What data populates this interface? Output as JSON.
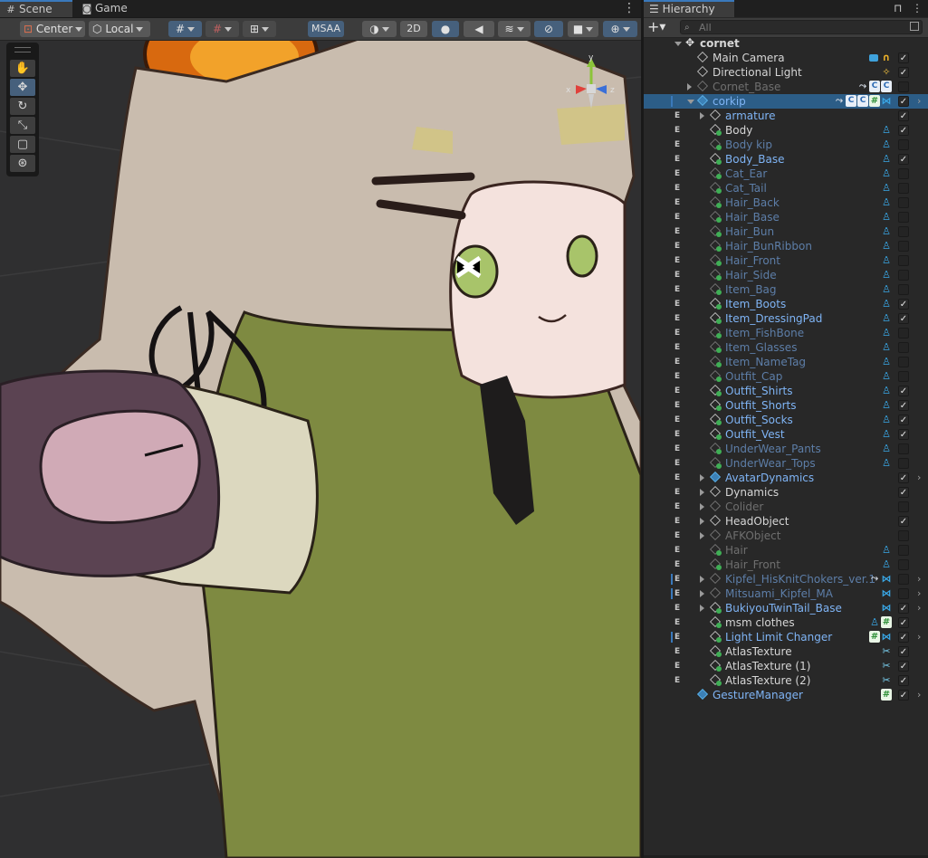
{
  "scene_tabs": [
    {
      "label": "Scene",
      "icon": "scene-grid-icon",
      "active": true
    },
    {
      "label": "Game",
      "icon": "gamepad-icon",
      "active": false
    }
  ],
  "scene_toolbar": {
    "pivot": "Center",
    "space": "Local",
    "msaa": "MSAA",
    "mode_2d": "2D"
  },
  "hierarchy": {
    "tab_label": "Hierarchy",
    "search_placeholder": "All",
    "rows": [
      {
        "label": "cornet",
        "depth": 0,
        "icon": "scene",
        "fold": "down",
        "style": "white",
        "e": false,
        "check": null,
        "badges": [],
        "arrow": false
      },
      {
        "label": "Main Camera",
        "depth": 1,
        "icon": "cube",
        "fold": "",
        "style": "white",
        "e": true,
        "check": true,
        "badges": [
          "camera-icon",
          "audio-listener-icon"
        ],
        "arrow": false
      },
      {
        "label": "Directional Light",
        "depth": 1,
        "icon": "cube",
        "fold": "",
        "style": "white",
        "e": true,
        "check": true,
        "badges": [
          "light-icon"
        ],
        "arrow": false
      },
      {
        "label": "Cornet_Base",
        "depth": 1,
        "icon": "cube-dim",
        "fold": "right",
        "style": "dim",
        "e": true,
        "check": false,
        "badges": [
          "armature-icon",
          "script-doc-icon",
          "script-doc-icon"
        ],
        "arrow": false
      },
      {
        "label": "corkip",
        "depth": 1,
        "icon": "cube-blue",
        "fold": "down",
        "style": "blue",
        "e": false,
        "bar": true,
        "selected": true,
        "check": true,
        "badges": [
          "armature-icon",
          "script-doc-icon",
          "script-doc-icon",
          "hash-script-icon",
          "physbone-icon"
        ],
        "arrow": true
      },
      {
        "label": "armature",
        "depth": 2,
        "icon": "cube",
        "fold": "right",
        "style": "blue",
        "e": true,
        "check": true,
        "badges": [],
        "arrow": false
      },
      {
        "label": "Body",
        "depth": 2,
        "icon": "mesh-cube",
        "fold": "",
        "style": "white",
        "e": true,
        "check": true,
        "badges": [
          "blendshape-icon"
        ],
        "arrow": false
      },
      {
        "label": "Body kip",
        "depth": 2,
        "icon": "mesh-cube-dim",
        "fold": "",
        "style": "dimblue",
        "e": true,
        "check": false,
        "badges": [
          "blendshape-icon"
        ],
        "arrow": false
      },
      {
        "label": "Body_Base",
        "depth": 2,
        "icon": "mesh-cube",
        "fold": "",
        "style": "blue",
        "e": true,
        "check": true,
        "badges": [
          "blendshape-icon"
        ],
        "arrow": false
      },
      {
        "label": "Cat_Ear",
        "depth": 2,
        "icon": "mesh-cube-dim",
        "fold": "",
        "style": "dimblue",
        "e": true,
        "check": false,
        "badges": [
          "blendshape-icon"
        ],
        "arrow": false
      },
      {
        "label": "Cat_Tail",
        "depth": 2,
        "icon": "mesh-cube-dim",
        "fold": "",
        "style": "dimblue",
        "e": true,
        "check": false,
        "badges": [
          "blendshape-icon"
        ],
        "arrow": false
      },
      {
        "label": "Hair_Back",
        "depth": 2,
        "icon": "mesh-cube-dim",
        "fold": "",
        "style": "dimblue",
        "e": true,
        "check": false,
        "badges": [
          "blendshape-icon"
        ],
        "arrow": false
      },
      {
        "label": "Hair_Base",
        "depth": 2,
        "icon": "mesh-cube-dim",
        "fold": "",
        "style": "dimblue",
        "e": true,
        "check": false,
        "badges": [
          "blendshape-icon"
        ],
        "arrow": false
      },
      {
        "label": "Hair_Bun",
        "depth": 2,
        "icon": "mesh-cube-dim",
        "fold": "",
        "style": "dimblue",
        "e": true,
        "check": false,
        "badges": [
          "blendshape-icon"
        ],
        "arrow": false
      },
      {
        "label": "Hair_BunRibbon",
        "depth": 2,
        "icon": "mesh-cube-dim",
        "fold": "",
        "style": "dimblue",
        "e": true,
        "check": false,
        "badges": [
          "blendshape-icon"
        ],
        "arrow": false
      },
      {
        "label": "Hair_Front",
        "depth": 2,
        "icon": "mesh-cube-dim",
        "fold": "",
        "style": "dimblue",
        "e": true,
        "check": false,
        "badges": [
          "blendshape-icon"
        ],
        "arrow": false
      },
      {
        "label": "Hair_Side",
        "depth": 2,
        "icon": "mesh-cube-dim",
        "fold": "",
        "style": "dimblue",
        "e": true,
        "check": false,
        "badges": [
          "blendshape-icon"
        ],
        "arrow": false
      },
      {
        "label": "Item_Bag",
        "depth": 2,
        "icon": "mesh-cube-dim",
        "fold": "",
        "style": "dimblue",
        "e": true,
        "check": false,
        "badges": [
          "blendshape-icon"
        ],
        "arrow": false
      },
      {
        "label": "Item_Boots",
        "depth": 2,
        "icon": "mesh-cube",
        "fold": "",
        "style": "blue",
        "e": true,
        "check": true,
        "badges": [
          "blendshape-icon"
        ],
        "arrow": false
      },
      {
        "label": "Item_DressingPad",
        "depth": 2,
        "icon": "mesh-cube",
        "fold": "",
        "style": "blue",
        "e": true,
        "check": true,
        "badges": [
          "blendshape-icon"
        ],
        "arrow": false
      },
      {
        "label": "Item_FishBone",
        "depth": 2,
        "icon": "mesh-cube-dim",
        "fold": "",
        "style": "dimblue",
        "e": true,
        "check": false,
        "badges": [
          "blendshape-icon"
        ],
        "arrow": false
      },
      {
        "label": "Item_Glasses",
        "depth": 2,
        "icon": "mesh-cube-dim",
        "fold": "",
        "style": "dimblue",
        "e": true,
        "check": false,
        "badges": [
          "blendshape-icon"
        ],
        "arrow": false
      },
      {
        "label": "Item_NameTag",
        "depth": 2,
        "icon": "mesh-cube-dim",
        "fold": "",
        "style": "dimblue",
        "e": true,
        "check": false,
        "badges": [
          "blendshape-icon"
        ],
        "arrow": false
      },
      {
        "label": "Outfit_Cap",
        "depth": 2,
        "icon": "mesh-cube-dim",
        "fold": "",
        "style": "dimblue",
        "e": true,
        "check": false,
        "badges": [
          "blendshape-icon"
        ],
        "arrow": false
      },
      {
        "label": "Outfit_Shirts",
        "depth": 2,
        "icon": "mesh-cube",
        "fold": "",
        "style": "blue",
        "e": true,
        "check": true,
        "badges": [
          "blendshape-icon"
        ],
        "arrow": false
      },
      {
        "label": "Outfit_Shorts",
        "depth": 2,
        "icon": "mesh-cube",
        "fold": "",
        "style": "blue",
        "e": true,
        "check": true,
        "badges": [
          "blendshape-icon"
        ],
        "arrow": false
      },
      {
        "label": "Outfit_Socks",
        "depth": 2,
        "icon": "mesh-cube",
        "fold": "",
        "style": "blue",
        "e": true,
        "check": true,
        "badges": [
          "blendshape-icon"
        ],
        "arrow": false
      },
      {
        "label": "Outfit_Vest",
        "depth": 2,
        "icon": "mesh-cube",
        "fold": "",
        "style": "blue",
        "e": true,
        "check": true,
        "badges": [
          "blendshape-icon"
        ],
        "arrow": false
      },
      {
        "label": "UnderWear_Pants",
        "depth": 2,
        "icon": "mesh-cube-dim",
        "fold": "",
        "style": "dimblue",
        "e": true,
        "check": false,
        "badges": [
          "blendshape-icon"
        ],
        "arrow": false
      },
      {
        "label": "UnderWear_Tops",
        "depth": 2,
        "icon": "mesh-cube-dim",
        "fold": "",
        "style": "dimblue",
        "e": true,
        "check": false,
        "badges": [
          "blendshape-icon"
        ],
        "arrow": false
      },
      {
        "label": "AvatarDynamics",
        "depth": 2,
        "icon": "cube-blue",
        "fold": "right",
        "style": "blue",
        "e": true,
        "check": true,
        "badges": [],
        "arrow": true
      },
      {
        "label": "Dynamics",
        "depth": 2,
        "icon": "cube",
        "fold": "right",
        "style": "white",
        "e": true,
        "check": true,
        "badges": [],
        "arrow": false
      },
      {
        "label": "Colider",
        "depth": 2,
        "icon": "cube-dim",
        "fold": "right",
        "style": "dim",
        "e": true,
        "check": false,
        "badges": [],
        "arrow": false
      },
      {
        "label": "HeadObject",
        "depth": 2,
        "icon": "cube",
        "fold": "right",
        "style": "white",
        "e": true,
        "check": true,
        "badges": [],
        "arrow": false
      },
      {
        "label": "AFKObject",
        "depth": 2,
        "icon": "cube-dim",
        "fold": "right",
        "style": "dim",
        "e": true,
        "check": false,
        "badges": [],
        "arrow": false
      },
      {
        "label": "Hair",
        "depth": 2,
        "icon": "mesh-cube-dim",
        "fold": "",
        "style": "dim",
        "e": true,
        "check": false,
        "badges": [
          "blendshape-icon"
        ],
        "arrow": false
      },
      {
        "label": "Hair_Front",
        "depth": 2,
        "icon": "mesh-cube-dim",
        "fold": "",
        "style": "dim",
        "e": true,
        "check": false,
        "badges": [
          "blendshape-icon"
        ],
        "arrow": false
      },
      {
        "label": "Kipfel_HisKnitChokers_ver.1",
        "depth": 2,
        "icon": "cube-dim",
        "fold": "right",
        "style": "dimblue",
        "e": true,
        "bar": true,
        "check": false,
        "badges": [
          "armature-icon",
          "physbone-icon"
        ],
        "arrow": true
      },
      {
        "label": "Mitsuami_Kipfel_MA",
        "depth": 2,
        "icon": "cube-dim",
        "fold": "right",
        "style": "dimblue",
        "e": true,
        "bar": true,
        "check": false,
        "badges": [
          "physbone-icon"
        ],
        "arrow": true
      },
      {
        "label": "BukiyouTwinTail_Base",
        "depth": 2,
        "icon": "mesh-cube",
        "fold": "right",
        "style": "blue",
        "e": true,
        "check": true,
        "badges": [
          "physbone-icon"
        ],
        "arrow": true
      },
      {
        "label": "msm clothes",
        "depth": 2,
        "icon": "mesh-cube",
        "fold": "",
        "style": "white",
        "e": true,
        "check": true,
        "badges": [
          "blendshape-icon",
          "hash-script-icon"
        ],
        "arrow": false
      },
      {
        "label": "Light Limit Changer",
        "depth": 2,
        "icon": "mesh-cube",
        "fold": "",
        "style": "blue",
        "e": true,
        "bar": true,
        "check": true,
        "badges": [
          "hash-script-icon",
          "physbone-icon"
        ],
        "arrow": true
      },
      {
        "label": "AtlasTexture",
        "depth": 2,
        "icon": "mesh-cube",
        "fold": "",
        "style": "white",
        "e": true,
        "check": true,
        "badges": [
          "atlas-icon"
        ],
        "arrow": false
      },
      {
        "label": "AtlasTexture (1)",
        "depth": 2,
        "icon": "mesh-cube",
        "fold": "",
        "style": "white",
        "e": true,
        "check": true,
        "badges": [
          "atlas-icon"
        ],
        "arrow": false
      },
      {
        "label": "AtlasTexture (2)",
        "depth": 2,
        "icon": "mesh-cube",
        "fold": "",
        "style": "white",
        "e": true,
        "check": true,
        "badges": [
          "atlas-icon"
        ],
        "arrow": false
      },
      {
        "label": "GestureManager",
        "depth": 1,
        "icon": "cube-blue",
        "fold": "",
        "style": "blue",
        "e": true,
        "check": true,
        "badges": [
          "hash-script-icon"
        ],
        "arrow": true
      }
    ]
  }
}
